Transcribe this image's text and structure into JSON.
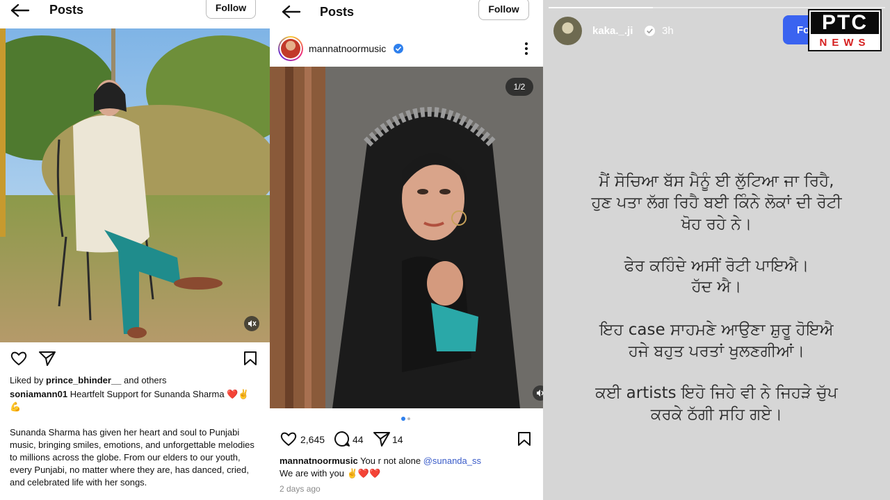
{
  "panel1": {
    "header_title": "Posts",
    "follow_label": "Follow",
    "liked_by_prefix": "Liked by",
    "liked_by_user": "prince_bhinder__",
    "liked_by_suffix": "and others",
    "caption_user": "soniamann01",
    "caption_text": "Heartfelt Support for Sunanda Sharma",
    "caption_emoji": "❤️✌️",
    "caption_emoji2": "💪",
    "body_text": "Sunanda Sharma has given her heart and soul to Punjabi music, bringing smiles, emotions, and unforgettable melodies to millions across the globe. From our elders to our youth, every Punjabi, no matter where they are, has danced, cried, and celebrated life with her songs."
  },
  "panel2": {
    "header_title": "Posts",
    "follow_label": "Follow",
    "username": "mannatnoormusic",
    "counter": "1/2",
    "likes": "2,645",
    "comments": "44",
    "shares": "14",
    "caption_user": "mannatnoormusic",
    "caption_text": "You r not alone",
    "caption_mention": "@sunanda_ss",
    "caption_line2": "We are with you ✌️❤️❤️",
    "timestamp": "2 days ago"
  },
  "panel3": {
    "username": "kaka._.ji",
    "time": "3h",
    "follow_label": "Fo",
    "logo_top": "PTC",
    "logo_bottom": "NEWS",
    "story_lines": [
      "ਮੈਂ ਸੋਚਿਆ ਬੱਸ ਮੈਨੂੰ ਈ ਲੁੱਟਿਆ ਜਾ ਰਿਹੈ,",
      "ਹੁਣ ਪਤਾ ਲੱਗ ਰਿਹੈ ਬਈ ਕਿੰਨੇ ਲੋਕਾਂ ਦੀ ਰੋਟੀ",
      "ਖੋਹ ਰਹੇ ਨੇ।",
      "ਫੇਰ ਕਹਿੰਦੇ ਅਸੀਂ ਰੋਟੀ ਪਾਇਐ।",
      "ਹੱਦ ਐ।",
      "ਇਹ case ਸਾਹਮਣੇ ਆਉਣਾ ਸ਼ੁਰੂ ਹੋਇਐ",
      "ਹਜੇ ਬਹੁਤ ਪਰਤਾਂ ਖੁਲਣਗੀਆਂ।",
      "ਕਈ artists ਇਹੋ ਜਿਹੇ ਵੀ ਨੇ ਜਿਹੜੇ ਚੁੱਪ",
      "ਕਰਕੇ ਠੱਗੀ ਸਹਿ ਗਏ।"
    ]
  },
  "colors": {
    "verified": "#2f80ed",
    "follow_blue": "#3a63f0",
    "ptc_red": "#d62020",
    "story_bg": "#d6d6d6"
  },
  "icons": [
    "back-arrow-icon",
    "heart-icon",
    "share-icon",
    "bookmark-icon",
    "mute-icon",
    "comment-icon",
    "more-icon",
    "verified-icon"
  ]
}
